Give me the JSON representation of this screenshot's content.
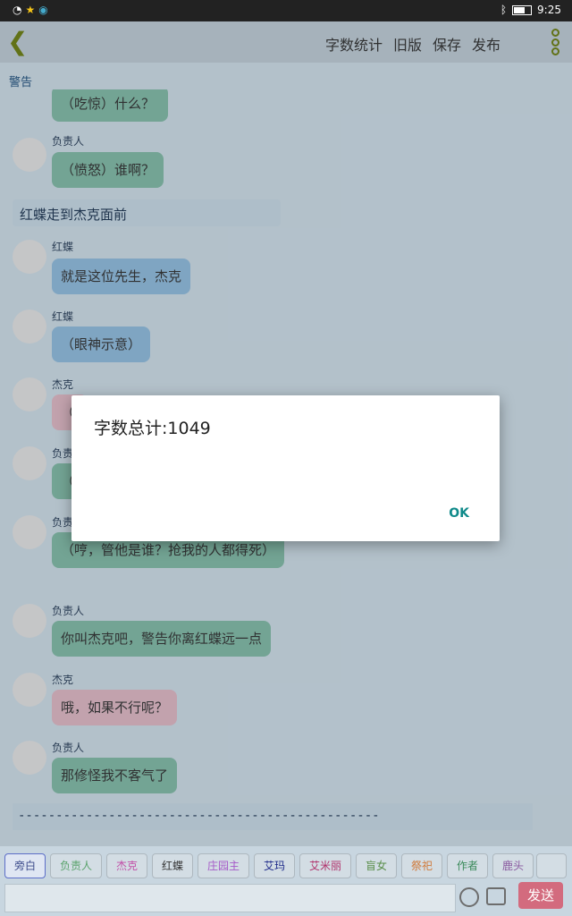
{
  "status": {
    "time": "9:25"
  },
  "topbar": {
    "menu": [
      "字数统计",
      "旧版",
      "保存",
      "发布"
    ]
  },
  "warning": "警告",
  "chat": {
    "partial_bubble": "（吃惊）什么？",
    "messages": [
      {
        "speaker": "负责人",
        "text": "（愤怒）谁啊？",
        "color": "#7fb6a2"
      },
      {
        "narration": "红蝶走到杰克面前"
      },
      {
        "speaker": "红蝶",
        "text": "就是这位先生，杰克",
        "color": "#8db7d6"
      },
      {
        "speaker": "红蝶",
        "text": "（眼神示意）",
        "color": "#8db7d6"
      },
      {
        "speaker": "杰克",
        "text": "（",
        "color": "#d9b3bf"
      },
      {
        "speaker": "负责人",
        "text": "（",
        "color": "#7fb6a2"
      },
      {
        "speaker": "负责人",
        "text": "（哼，管他是谁？抢我的人都得死）",
        "color": "#7fb6a2"
      },
      {
        "speaker": "负责人",
        "text": "你叫杰克吧，警告你离红蝶远一点",
        "color": "#7fb6a2"
      },
      {
        "speaker": "杰克",
        "text": "哦，如果不行呢？",
        "color": "#d9b3bf"
      },
      {
        "speaker": "负责人",
        "text": "那修怪我不客气了",
        "color": "#7fb6a2"
      }
    ],
    "separator": "------------------------------------------------"
  },
  "dialog": {
    "title": "字数总计:1049",
    "ok": "OK"
  },
  "roles": [
    {
      "label": "旁白",
      "color": "#3b4a8a"
    },
    {
      "label": "负责人",
      "color": "#5aa36c"
    },
    {
      "label": "杰克",
      "color": "#c24fa8"
    },
    {
      "label": "红蝶",
      "color": "#333333"
    },
    {
      "label": "庄园主",
      "color": "#a65ac8"
    },
    {
      "label": "艾玛",
      "color": "#1e2a8a"
    },
    {
      "label": "艾米丽",
      "color": "#b0306a"
    },
    {
      "label": "盲女",
      "color": "#5a8e4a"
    },
    {
      "label": "祭祀",
      "color": "#d07a3a"
    },
    {
      "label": "作者",
      "color": "#3a8a5a"
    },
    {
      "label": "鹿头",
      "color": "#8a5aa0"
    }
  ],
  "input": {
    "send": "发送"
  }
}
